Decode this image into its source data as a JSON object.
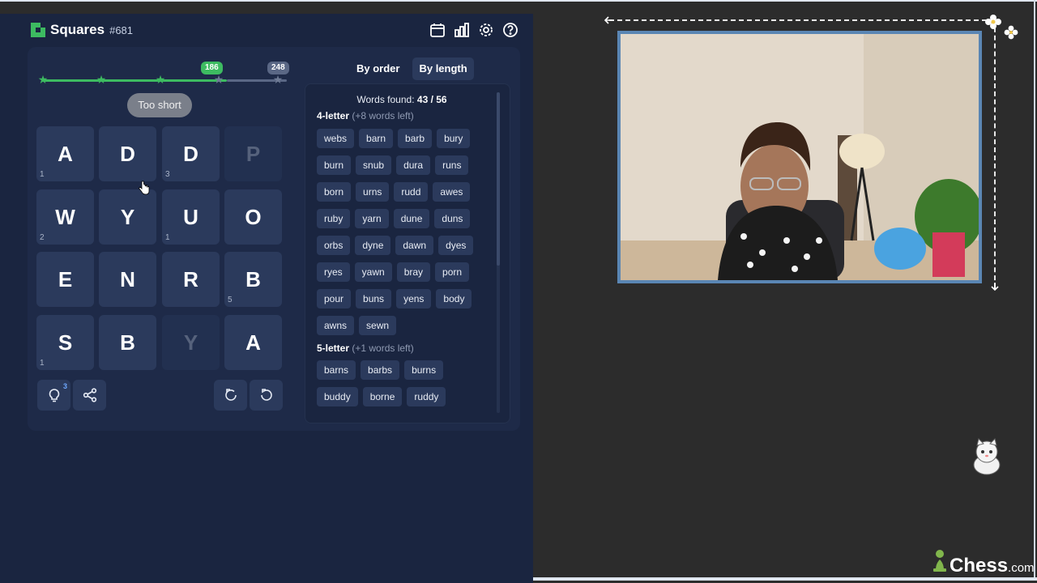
{
  "header": {
    "title": "Squares",
    "puzzle_number": "#681",
    "icons": [
      "calendar-icon",
      "stats-icon",
      "settings-icon",
      "help-icon"
    ]
  },
  "progress": {
    "current_score": "186",
    "max_score": "248",
    "stars_filled": 3,
    "stars_total": 5,
    "accent": "#3dbb61"
  },
  "toast": "Too short",
  "tabs": {
    "by_order": "By order",
    "by_length": "By length"
  },
  "grid": [
    {
      "letter": "A",
      "num": "1",
      "dim": false
    },
    {
      "letter": "D",
      "num": "",
      "dim": false
    },
    {
      "letter": "D",
      "num": "3",
      "dim": false
    },
    {
      "letter": "P",
      "num": "",
      "dim": true
    },
    {
      "letter": "W",
      "num": "2",
      "dim": false
    },
    {
      "letter": "Y",
      "num": "",
      "dim": false
    },
    {
      "letter": "U",
      "num": "1",
      "dim": false
    },
    {
      "letter": "O",
      "num": "",
      "dim": false
    },
    {
      "letter": "E",
      "num": "",
      "dim": false
    },
    {
      "letter": "N",
      "num": "",
      "dim": false
    },
    {
      "letter": "R",
      "num": "",
      "dim": false
    },
    {
      "letter": "B",
      "num": "5",
      "dim": false
    },
    {
      "letter": "S",
      "num": "1",
      "dim": false
    },
    {
      "letter": "B",
      "num": "",
      "dim": false
    },
    {
      "letter": "Y",
      "num": "",
      "dim": true
    },
    {
      "letter": "A",
      "num": "",
      "dim": false
    }
  ],
  "tools": {
    "hint_count": "3"
  },
  "words": {
    "found_label": "Words found:",
    "found_value": "43 / 56",
    "group4_label": "4-letter",
    "group4_left": "(+8 words left)",
    "group4": [
      "webs",
      "barn",
      "barb",
      "bury",
      "burn",
      "snub",
      "dura",
      "runs",
      "born",
      "urns",
      "rudd",
      "awes",
      "ruby",
      "yarn",
      "dune",
      "duns",
      "orbs",
      "dyne",
      "dawn",
      "dyes",
      "ryes",
      "yawn",
      "bray",
      "porn",
      "pour",
      "buns",
      "yens",
      "body",
      "awns",
      "sewn"
    ],
    "group5_label": "5-letter",
    "group5_left": "(+1 words left)",
    "group5": [
      "barns",
      "barbs",
      "burns",
      "buddy",
      "borne",
      "ruddy"
    ]
  },
  "brand": {
    "name": "Chess",
    "suffix": ".com"
  }
}
